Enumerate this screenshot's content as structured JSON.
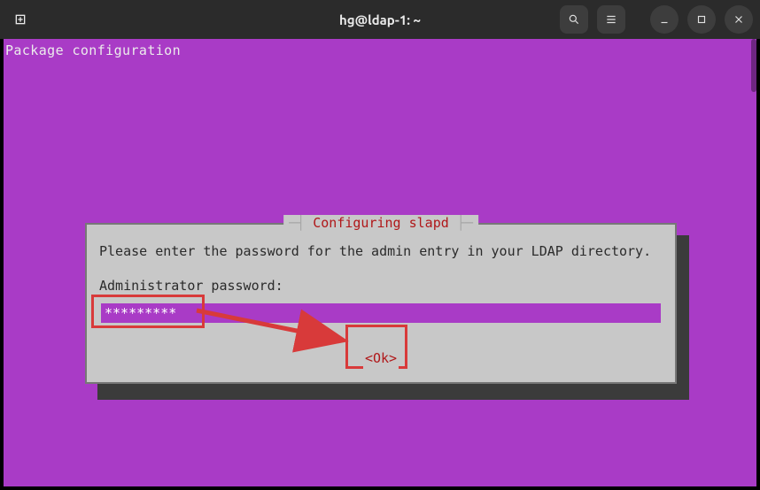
{
  "window": {
    "title": "hg@ldap-1: ~"
  },
  "terminal": {
    "header": "Package configuration"
  },
  "dialog": {
    "title_label": "Configuring slapd",
    "prompt_line": "Please enter the password for the admin entry in your LDAP directory.",
    "field_label": "Administrator password:",
    "password_mask": "*********",
    "ok_label": "<Ok>"
  },
  "colors": {
    "magenta": "#a93bc6",
    "annotation_red": "#d83a3a",
    "dialog_bg": "#c8c8c8"
  }
}
